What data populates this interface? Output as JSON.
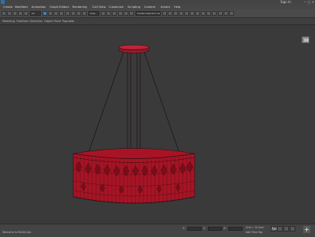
{
  "titlebar": {
    "sign_in": "Sign In",
    "window_buttons": "— ▢ ✕"
  },
  "menu": {
    "items": [
      "Create",
      "Modifiers",
      "Animation",
      "Graph Editors",
      "Rendering",
      "Civil View",
      "Customize",
      "Scripting",
      "Content",
      "Arnold",
      "Help"
    ]
  },
  "toolbar": {
    "filter_all": "All",
    "view_label": "View",
    "selection_set": "Create Selection Set"
  },
  "ribbon": {
    "tabs": [
      "Modeling",
      "Freeform",
      "Selection",
      "Object Paint",
      "Populate"
    ]
  },
  "viewport": {
    "model_color": "#b1182a",
    "wire_color": "#2b0f12"
  },
  "statusbar": {
    "welcome": "Welcome to MAXScript.",
    "x_label": "X:",
    "y_label": "Y:",
    "z_label": "Z:",
    "grid": "Grid = 10.0cm",
    "add_time_tag": "Add Time Tag",
    "auto_key": "Auto",
    "add_button": "+"
  }
}
